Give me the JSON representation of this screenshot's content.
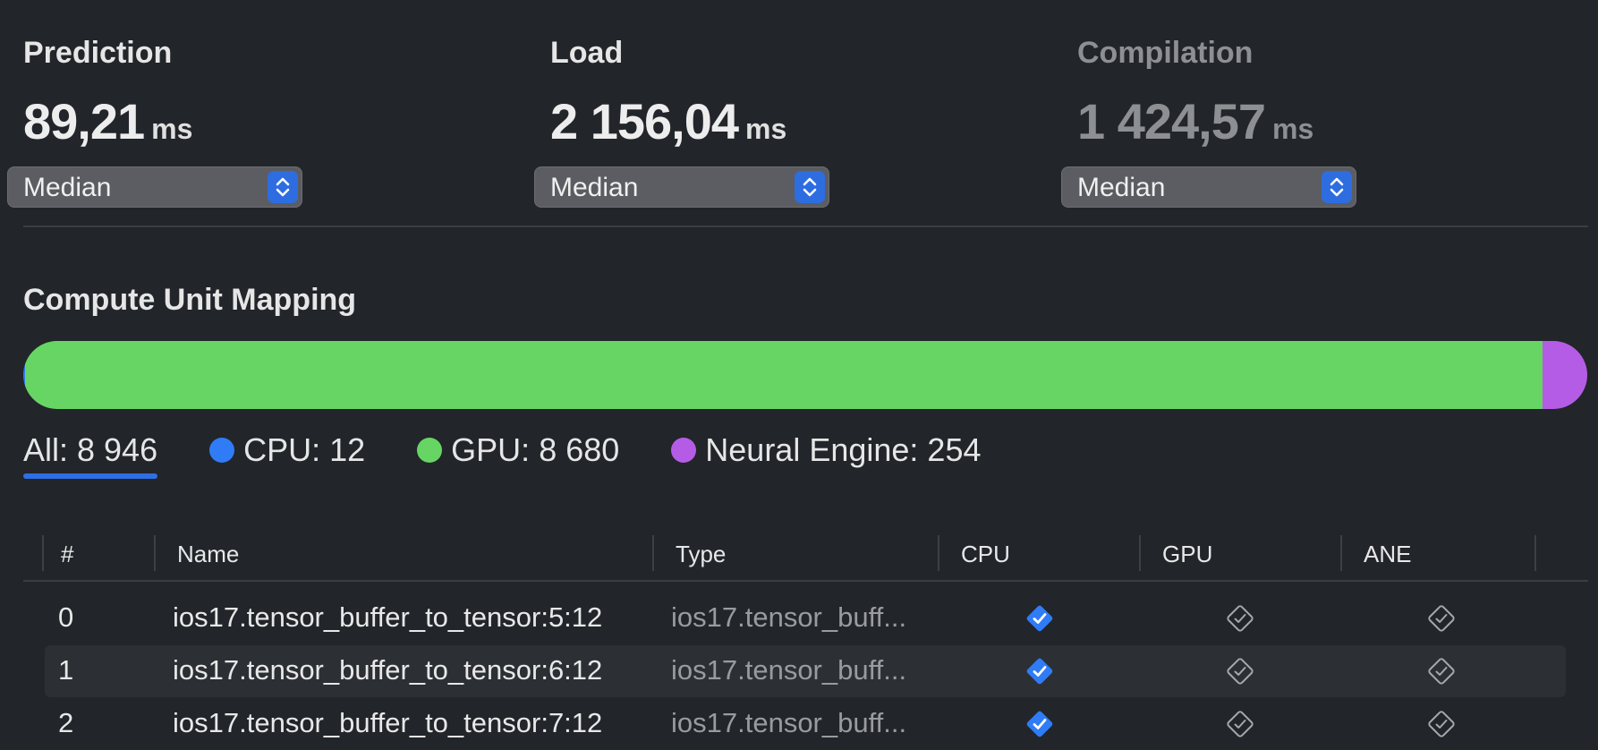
{
  "metrics": [
    {
      "title": "Prediction",
      "value": "89,21",
      "unit": "ms",
      "stat": "Median"
    },
    {
      "title": "Load",
      "value": "2 156,04",
      "unit": "ms",
      "stat": "Median"
    },
    {
      "title": "Compilation",
      "value": "1 424,57",
      "unit": "ms",
      "stat": "Median"
    }
  ],
  "mapping": {
    "title": "Compute Unit Mapping",
    "total": 8946,
    "segments": [
      {
        "name": "CPU",
        "count": 12,
        "color": "#2f7cf6"
      },
      {
        "name": "GPU",
        "count": 8680,
        "color": "#67d564"
      },
      {
        "name": "Neural Engine",
        "count": 254,
        "color": "#b55ce6"
      }
    ],
    "legend": {
      "all": "All: 8 946",
      "cpu": "CPU: 12",
      "gpu": "GPU: 8 680",
      "ane": "Neural Engine: 254"
    }
  },
  "table": {
    "headers": {
      "num": "#",
      "name": "Name",
      "type": "Type",
      "cpu": "CPU",
      "gpu": "GPU",
      "ane": "ANE"
    },
    "rows": [
      {
        "num": "0",
        "name": "ios17.tensor_buffer_to_tensor:5:12",
        "type": "ios17.tensor_buff...",
        "cpu": true,
        "gpu": false,
        "ane": false
      },
      {
        "num": "1",
        "name": "ios17.tensor_buffer_to_tensor:6:12",
        "type": "ios17.tensor_buff...",
        "cpu": true,
        "gpu": false,
        "ane": false
      },
      {
        "num": "2",
        "name": "ios17.tensor_buffer_to_tensor:7:12",
        "type": "ios17.tensor_buff...",
        "cpu": true,
        "gpu": false,
        "ane": false
      }
    ]
  },
  "colors": {
    "accent": "#2f6fe6",
    "checked": "#2f7cf6",
    "unchecked": "#a7a8ab"
  }
}
